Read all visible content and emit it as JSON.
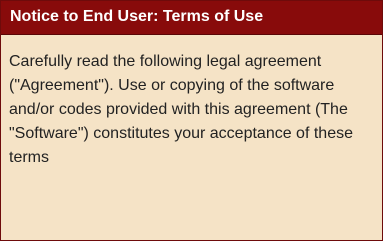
{
  "notice": {
    "title": "Notice to End User: Terms of Use",
    "body": "Carefully read the following legal agreement (\"Agreement\"). Use or copying of the software and/or codes provided with this agreement (The \"Software\") constitutes your acceptance of these terms"
  },
  "colors": {
    "header_background": "#880b0b",
    "panel_background": "#f5e3c6",
    "title_text": "#ffffff",
    "body_text": "#222222"
  }
}
